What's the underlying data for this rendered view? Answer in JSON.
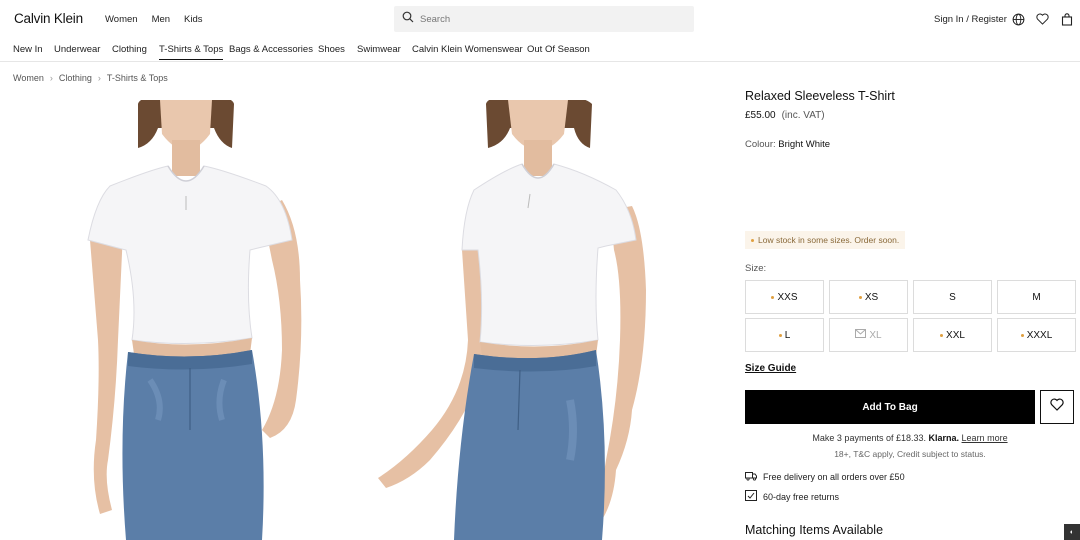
{
  "header": {
    "logo": "Calvin Klein",
    "nav": [
      "Women",
      "Men",
      "Kids"
    ],
    "search_placeholder": "Search",
    "signin": "Sign In / Register",
    "icons": [
      "globe-icon",
      "heart-icon",
      "bag-icon"
    ]
  },
  "categories": {
    "items": [
      "New In",
      "Underwear",
      "Clothing",
      "T-Shirts & Tops",
      "Bags & Accessories",
      "Shoes",
      "Swimwear",
      "Calvin Klein Womenswear",
      "Out Of Season"
    ],
    "active": "T-Shirts & Tops"
  },
  "breadcrumb": [
    "Women",
    "Clothing",
    "T-Shirts & Tops"
  ],
  "product": {
    "title": "Relaxed Sleeveless T-Shirt",
    "price": "£55.00",
    "vat": "(inc. VAT)",
    "colour_label": "Colour:",
    "colour_value": "Bright White",
    "stock_notice": "Low stock in some sizes. Order soon.",
    "size_label": "Size:",
    "sizes": [
      {
        "label": "XXS",
        "low_stock": true,
        "available": true
      },
      {
        "label": "XS",
        "low_stock": true,
        "available": true
      },
      {
        "label": "S",
        "low_stock": false,
        "available": true
      },
      {
        "label": "M",
        "low_stock": false,
        "available": true
      },
      {
        "label": "L",
        "low_stock": true,
        "available": true
      },
      {
        "label": "XL",
        "low_stock": false,
        "available": false
      },
      {
        "label": "XXL",
        "low_stock": true,
        "available": true
      },
      {
        "label": "XXXL",
        "low_stock": true,
        "available": true
      }
    ],
    "size_guide": "Size Guide",
    "add_to_bag": "Add To Bag",
    "klarna_text": "Make 3 payments of £18.33.",
    "klarna_brand": "Klarna.",
    "klarna_learn": "Learn more",
    "klarna_terms": "18+, T&C apply, Credit subject to status.",
    "perks": [
      "Free delivery on all orders over £50",
      "60-day free returns"
    ],
    "matching_title": "Matching Items Available"
  },
  "colors": {
    "low_stock_dot": "#e0a040",
    "stock_bg": "#fbf4ea",
    "button_bg": "#000000"
  }
}
